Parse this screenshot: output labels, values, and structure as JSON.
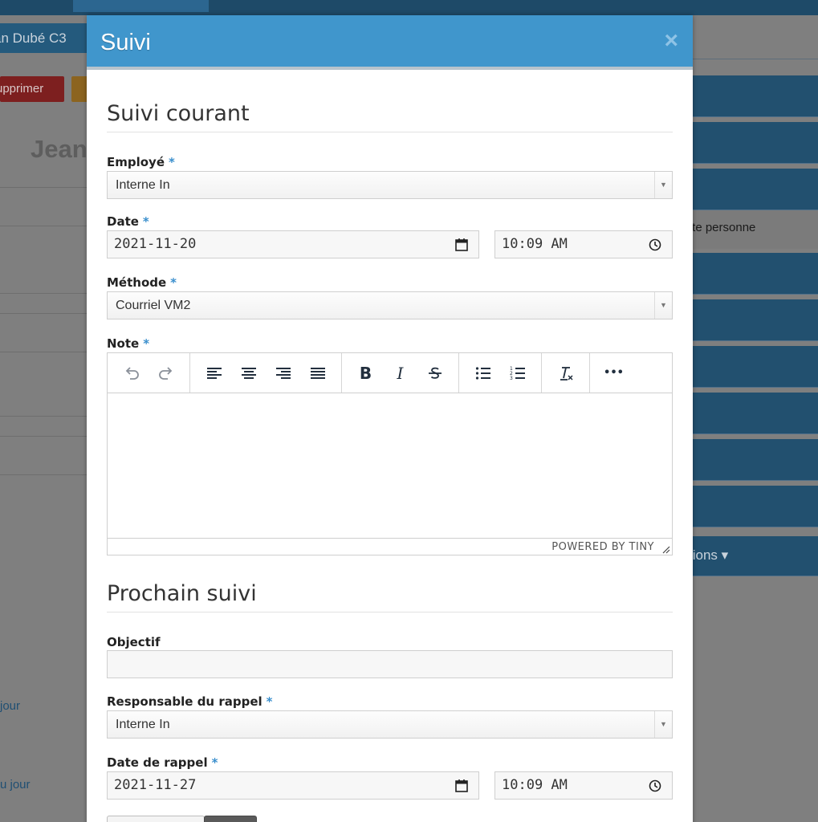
{
  "background": {
    "name_tab": "an Dubé C3",
    "delete_button": "upprimer",
    "heading": "Jean",
    "link_1": "jour",
    "link_2": "u jour",
    "right_plain": "tte personne",
    "actions": "tions ▾"
  },
  "modal": {
    "title": "Suivi",
    "close_glyph": "×"
  },
  "current": {
    "section_title": "Suivi courant",
    "employee_label": "Employé",
    "employee_value": "Interne In",
    "date_label": "Date",
    "date_value": "2021-11-20",
    "time_value": "10:09 AM",
    "method_label": "Méthode",
    "method_value": "Courriel VM2",
    "note_label": "Note",
    "powered_by": "POWERED BY TINY"
  },
  "next": {
    "section_title": "Prochain suivi",
    "objective_label": "Objectif",
    "objective_value": "",
    "responsible_label": "Responsable du rappel",
    "responsible_value": "Interne In",
    "reminder_label": "Date de rappel",
    "reminder_date_value": "2021-11-27",
    "reminder_time_value": "10:09 AM"
  },
  "required_marker": "*",
  "select_arrow": "▼",
  "editor_toolbar": {
    "bold": "B",
    "italic": "I",
    "more": "•••"
  },
  "colors": {
    "modal_header": "#4096cc",
    "required": "#3a8fcd",
    "background_overlay": "#7f7f7f",
    "background_bar": "#22506f"
  }
}
